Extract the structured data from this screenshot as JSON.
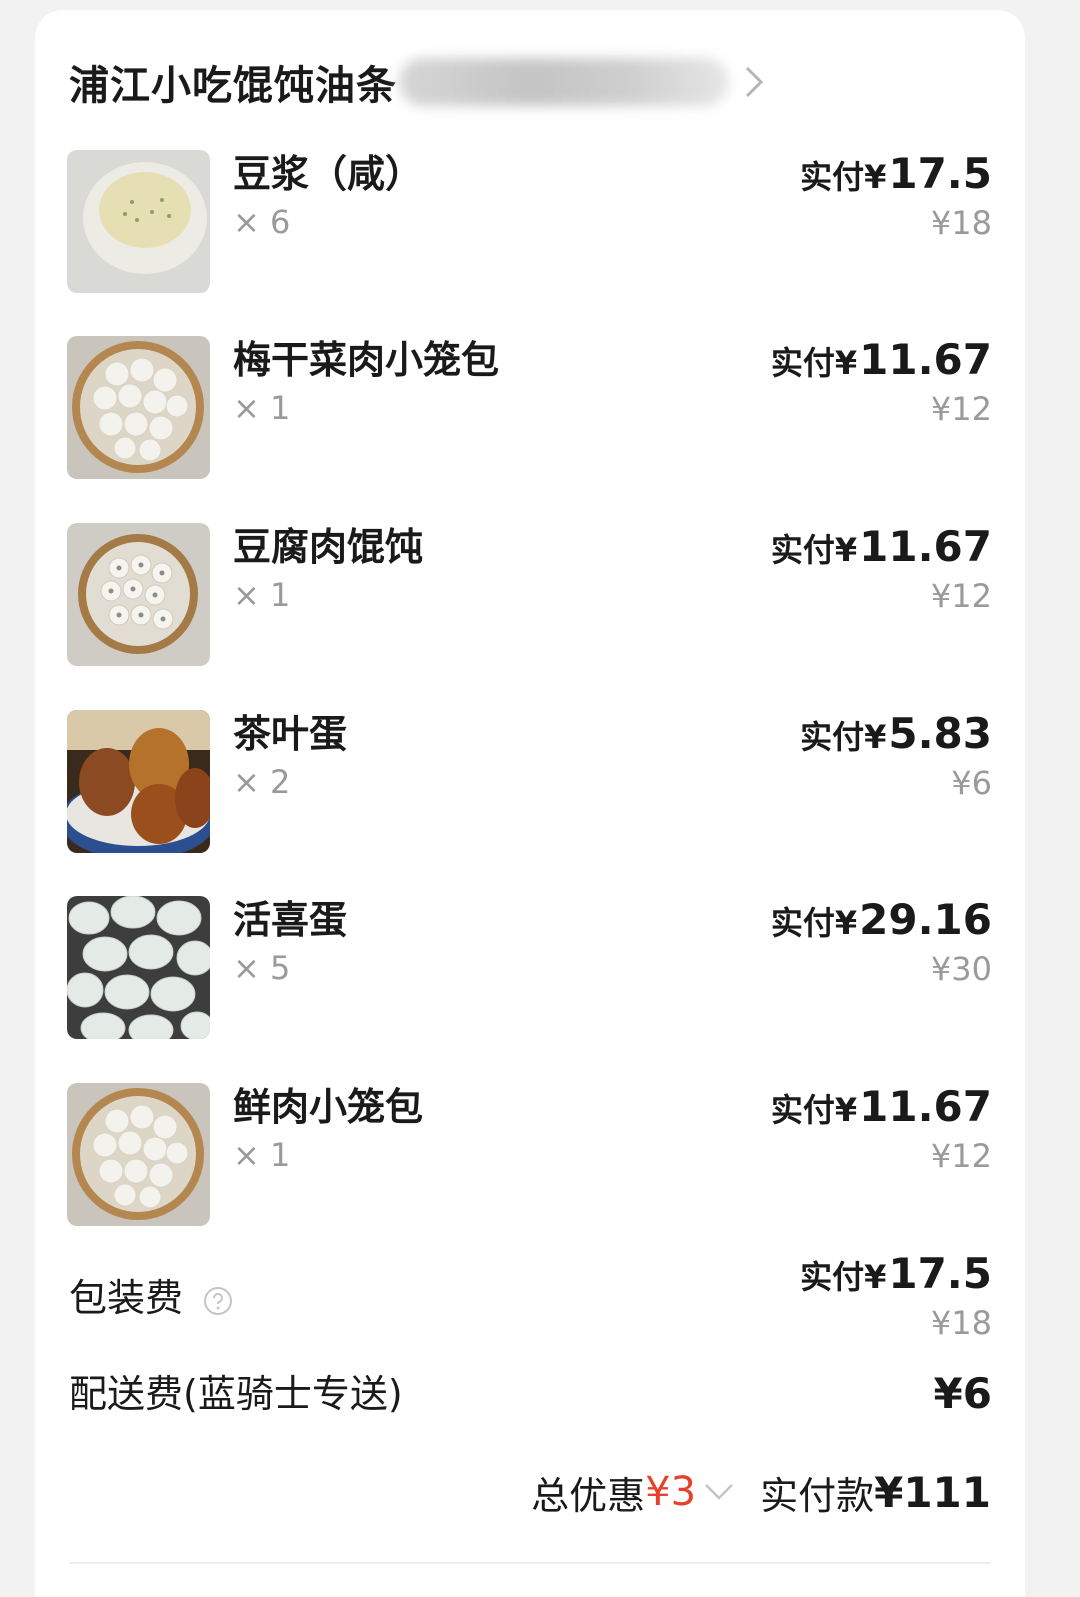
{
  "shop": {
    "name": "浦江小吃馄饨油条"
  },
  "items": [
    {
      "name": "豆浆（咸）",
      "qty": "× 6",
      "paid_label": "实付¥",
      "paid": "17.5",
      "original": "¥18",
      "thumb": "soy-milk-bowl"
    },
    {
      "name": "梅干菜肉小笼包",
      "qty": "× 1",
      "paid_label": "实付¥",
      "paid": "11.67",
      "original": "¥12",
      "thumb": "steamer-buns"
    },
    {
      "name": "豆腐肉馄饨",
      "qty": "× 1",
      "paid_label": "实付¥",
      "paid": "11.67",
      "original": "¥12",
      "thumb": "steamer-wontons"
    },
    {
      "name": "茶叶蛋",
      "qty": "× 2",
      "paid_label": "实付¥",
      "paid": "5.83",
      "original": "¥6",
      "thumb": "tea-eggs-bowl"
    },
    {
      "name": "活喜蛋",
      "qty": "× 5",
      "paid_label": "实付¥",
      "paid": "29.16",
      "original": "¥30",
      "thumb": "white-eggs"
    },
    {
      "name": "鲜肉小笼包",
      "qty": "× 1",
      "paid_label": "实付¥",
      "paid": "11.67",
      "original": "¥12",
      "thumb": "steamer-buns"
    }
  ],
  "packaging": {
    "label": "包装费",
    "paid_label": "实付¥",
    "paid": "17.5",
    "original": "¥18"
  },
  "delivery": {
    "label": "配送费(蓝骑士专送)",
    "amount": "¥6"
  },
  "summary": {
    "discount_label": "总优惠",
    "discount_value": "¥3",
    "total_label": "实付款",
    "total_value": "¥111"
  },
  "colors": {
    "discount": "#e6412b",
    "muted": "#9a9a9a"
  }
}
